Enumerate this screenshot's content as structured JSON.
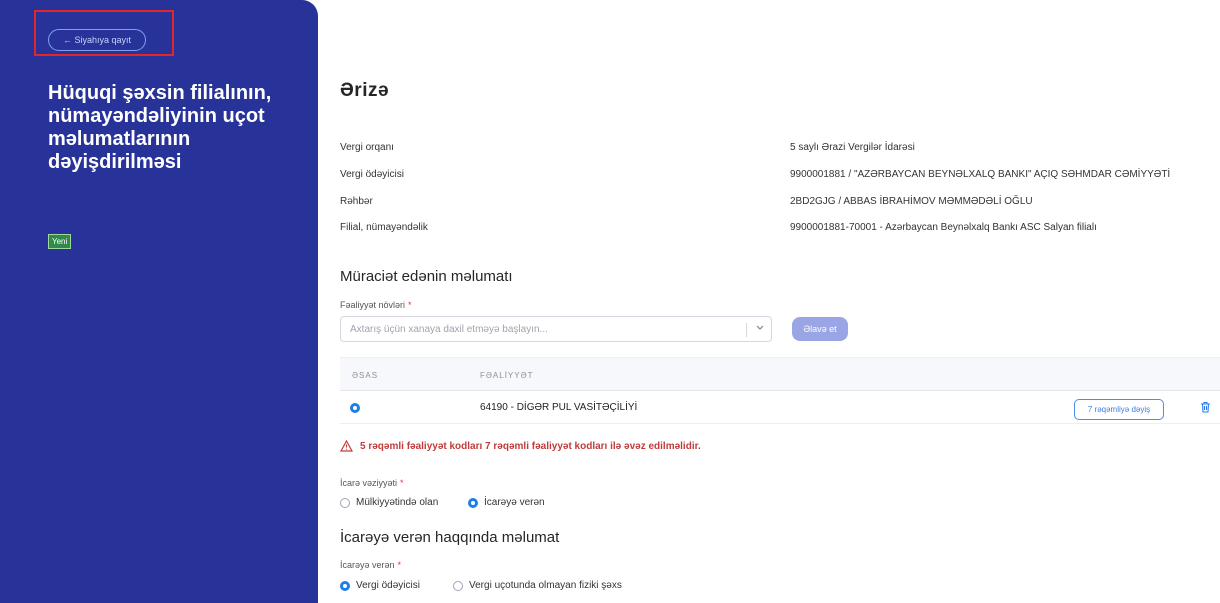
{
  "sidebar": {
    "back_label": "← Siyahıya qayıt",
    "title": "Hüquqi şəxsin filialının, nümayəndəliyinin uçot məlumatlarının dəyişdirilməsi",
    "status": "Yeni",
    "bg_color": "#28339a"
  },
  "main": {
    "title": "Ərizə",
    "info": [
      {
        "label": "Vergi orqanı",
        "value": "5 saylı Ərazi Vergilər İdarəsi"
      },
      {
        "label": "Vergi ödəyicisi",
        "value": "9900001881 / \"AZƏRBAYCAN BEYNƏLXALQ BANKI\" AÇIQ SƏHMDAR CƏMİYYƏTİ"
      },
      {
        "label": "Rəhbər",
        "value": "2BD2GJG / ABBAS İBRAHİMOV MƏMMƏDƏLİ OĞLU"
      },
      {
        "label": "Filial, nümayəndəlik",
        "value": "9900001881-70001 - Azərbaycan Beynəlxalq Bankı ASC Salyan filialı"
      }
    ],
    "applicant_title": "Müraciət edənin məlumatı",
    "activity_label": "Fəaliyyət növləri",
    "required_mark": "*",
    "activity_placeholder": "Axtarış üçün xanaya daxil etməyə başlayın...",
    "add_button": "Əlavə et",
    "table": {
      "headers": [
        "ƏSAS",
        "FƏALİYYƏT"
      ],
      "rows": [
        {
          "activity": "64190 - DİGƏR PUL VASİTƏÇİLİYİ",
          "main": true,
          "action": "7 rəqəmliyə dəyiş"
        }
      ]
    },
    "warning": "5 rəqəmli fəaliyyət kodları 7 rəqəmli fəaliyyət kodları ilə əvəz edilməlidir.",
    "rent_status": {
      "label": "İcarə vəziyyəti",
      "options": [
        "Mülkiyyətində olan",
        "İcarəyə verən"
      ],
      "selected": "İcarəyə verən"
    },
    "lessor_section_title": "İcarəyə verən haqqında məlumat",
    "lessor": {
      "label": "İcarəyə verən",
      "options": [
        "Vergi ödəyicisi",
        "Vergi uçotunda olmayan fiziki şəxs"
      ],
      "selected": "Vergi ödəyicisi"
    },
    "accent_color": "#1e7ee8",
    "warning_color": "#c13b3b"
  }
}
